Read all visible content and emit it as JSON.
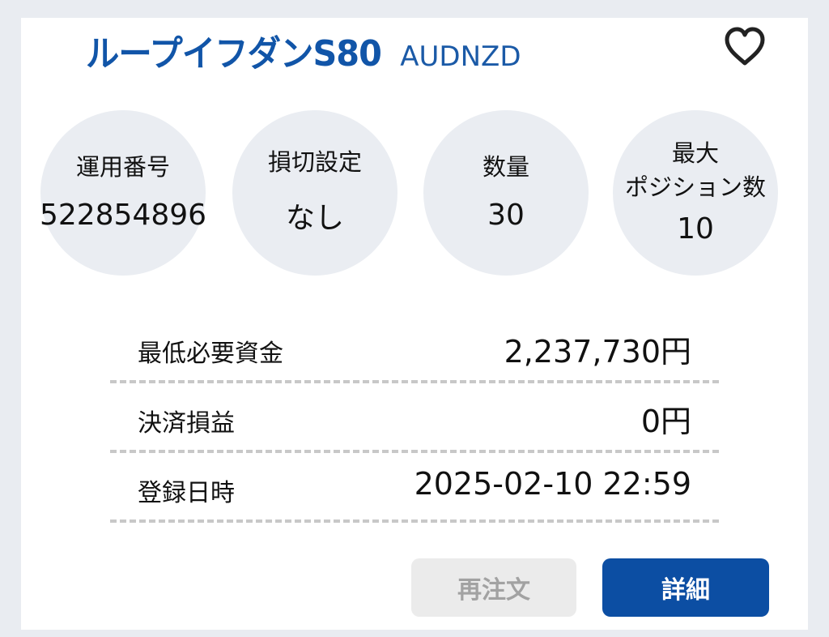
{
  "header": {
    "strategy_name": "ループイフダンS80",
    "currency_pair": "AUDNZD",
    "favorite_icon": "heart-outline-icon"
  },
  "stats": [
    {
      "label": "運用番号",
      "value": "522854896"
    },
    {
      "label": "損切設定",
      "value": "なし"
    },
    {
      "label": "数量",
      "value": "30"
    },
    {
      "label_line1": "最大",
      "label_line2": "ポジション数",
      "value": "10"
    }
  ],
  "details": [
    {
      "label": "最低必要資金",
      "value": "2,237,730円"
    },
    {
      "label": "決済損益",
      "value": "0円"
    },
    {
      "label": "登録日時",
      "value": "2025-02-10 22:59"
    }
  ],
  "buttons": {
    "reorder_label": "再注文",
    "detail_label": "詳細"
  },
  "colors": {
    "brand_blue": "#1155a8",
    "primary_button": "#0c4ea3",
    "disabled_button": "#ebebeb",
    "circle_bg": "#eaedf2"
  }
}
